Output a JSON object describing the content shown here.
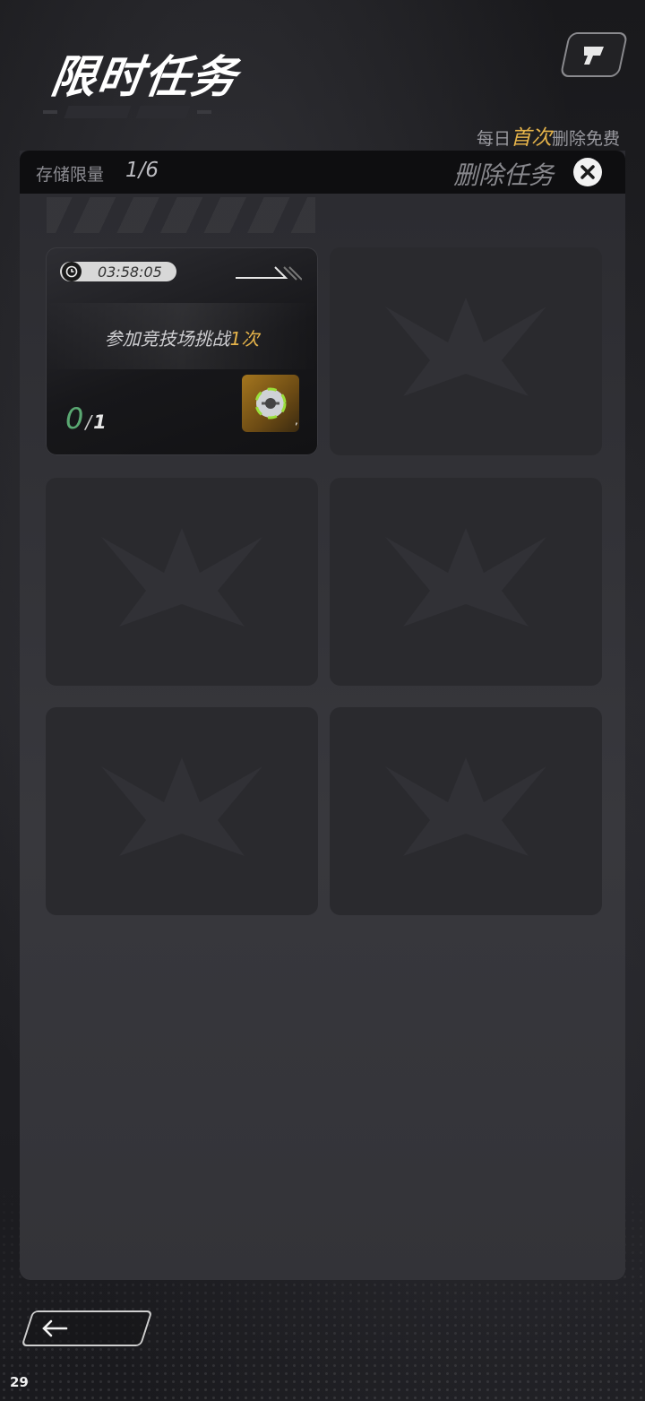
{
  "header": {
    "title": "限时任务",
    "free_note": {
      "prefix": "每日",
      "highlight": "首次",
      "suffix": "删除免费"
    }
  },
  "panel": {
    "storage_label": "存储限量",
    "storage_count": "1/6",
    "delete_label": "删除任务"
  },
  "task": {
    "timer": "03:58:05",
    "description": "参加竞技场挑战",
    "description_highlight": "1次",
    "progress_current": "0",
    "progress_separator": "/",
    "progress_total": "1",
    "reward_count": ","
  },
  "footer": {
    "page_number": "29"
  },
  "colors": {
    "accent_gold": "#e5b34a",
    "progress_green": "#5aa872"
  },
  "icons": [
    "help-icon",
    "close-icon",
    "clock-icon",
    "arrow-icon",
    "reward-item-icon",
    "back-arrow-icon"
  ]
}
